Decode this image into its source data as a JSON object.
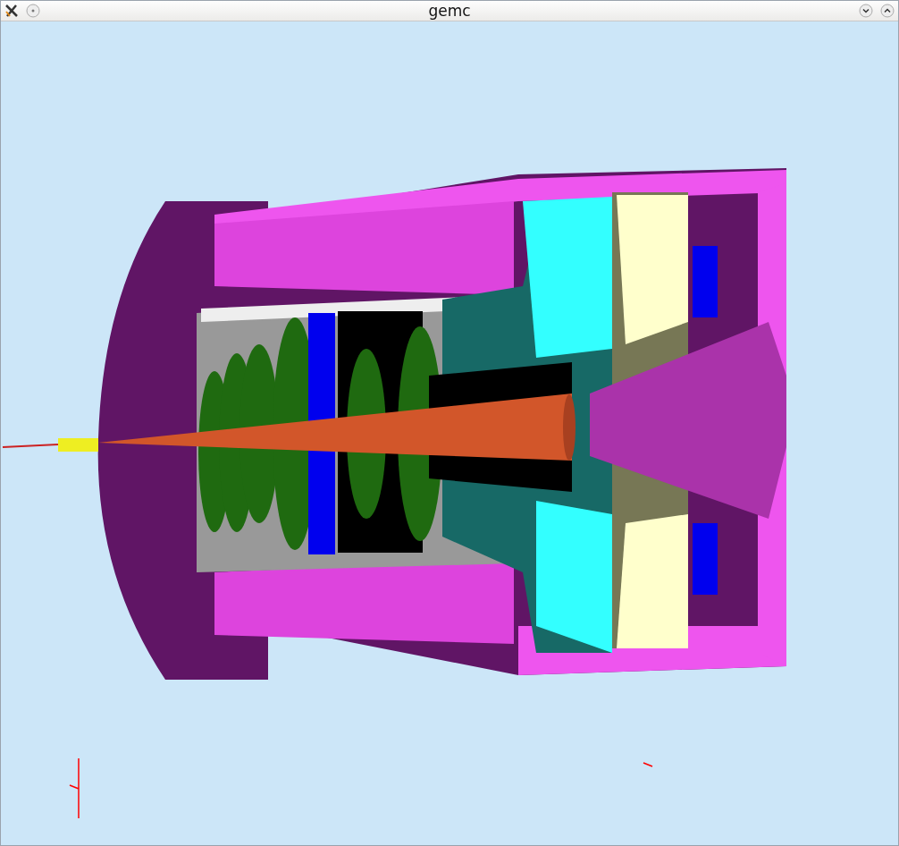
{
  "window": {
    "title": "gemc"
  }
}
